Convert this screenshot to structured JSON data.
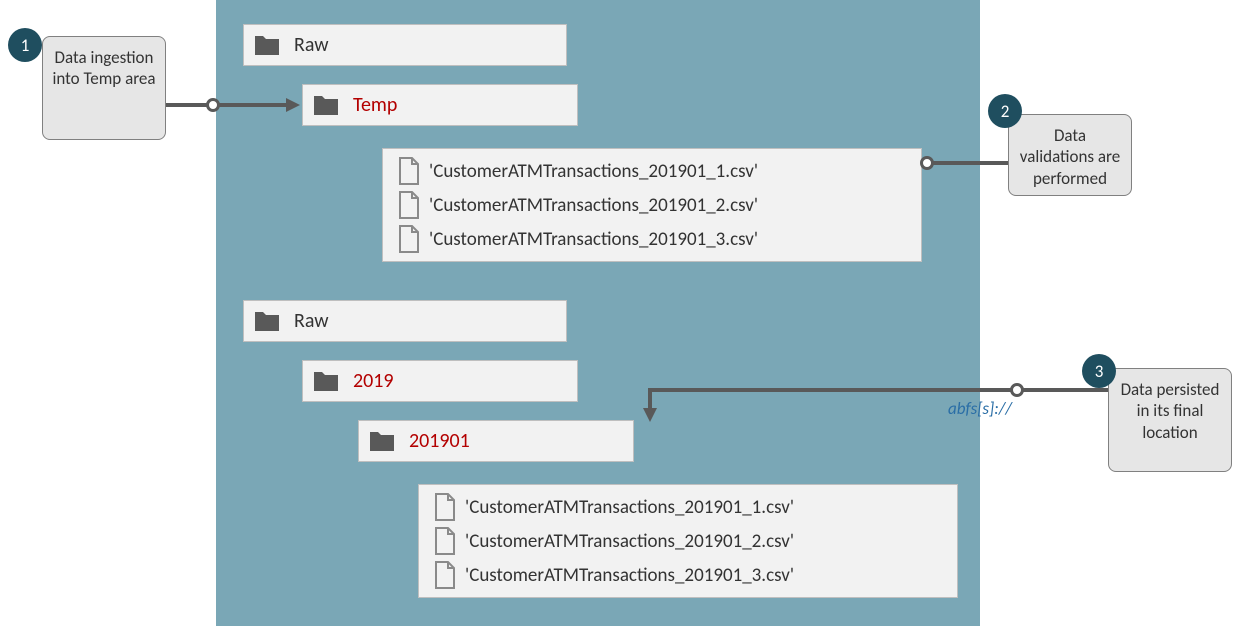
{
  "folders_top": {
    "raw": "Raw",
    "temp": "Temp"
  },
  "files_top": [
    "'CustomerATMTransactions_201901_1.csv'",
    "'CustomerATMTransactions_201901_2.csv'",
    "'CustomerATMTransactions_201901_3.csv'"
  ],
  "folders_bottom": {
    "raw": "Raw",
    "year": "2019",
    "month": "201901"
  },
  "files_bottom": [
    "'CustomerATMTransactions_201901_1.csv'",
    "'CustomerATMTransactions_201901_2.csv'",
    "'CustomerATMTransactions_201901_3.csv'"
  ],
  "callouts": {
    "c1": {
      "num": "1",
      "text": "Data ingestion into Temp area"
    },
    "c2": {
      "num": "2",
      "text": "Data validations are performed"
    },
    "c3": {
      "num": "3",
      "text": "Data persisted in its final location"
    }
  },
  "protocol_label": "abfs[s]://"
}
